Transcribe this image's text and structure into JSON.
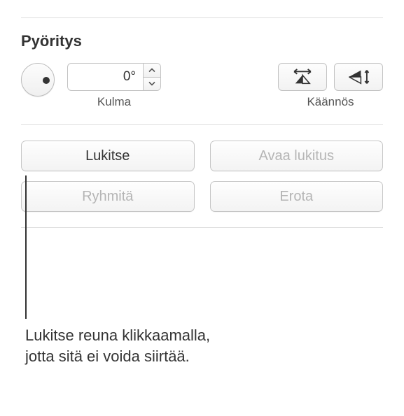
{
  "section": {
    "title": "Pyöritys"
  },
  "rotation": {
    "angle_value": "0°",
    "angle_label": "Kulma",
    "flip_label": "Käännös"
  },
  "buttons": {
    "lock": "Lukitse",
    "unlock": "Avaa lukitus",
    "group": "Ryhmitä",
    "ungroup": "Erota"
  },
  "callout": {
    "text": "Lukitse reuna klikkaamalla, jotta sitä ei voida siirtää."
  }
}
